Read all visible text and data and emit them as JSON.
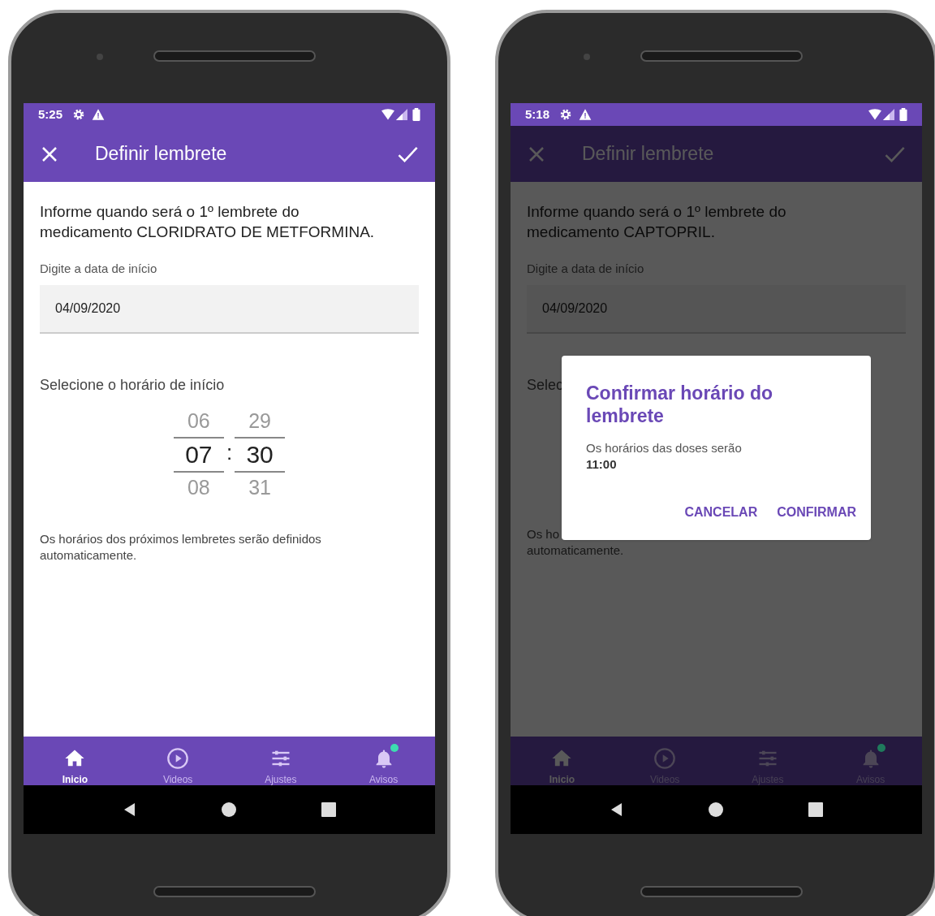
{
  "phones": [
    {
      "status_time": "5:25",
      "title": "Definir lembrete",
      "dimmed": false,
      "intro": "Informe quando será o 1º lembrete do medicamento CLORIDRATO DE METFORMINA.",
      "date_label": "Digite a data de início",
      "date_value": "04/09/2020",
      "time_label": "Selecione o horário de início",
      "picker": {
        "separator": ":",
        "hours": [
          {
            "value": "06",
            "selected": false
          },
          {
            "value": "07",
            "selected": true
          },
          {
            "value": "08",
            "selected": false
          }
        ],
        "minutes": [
          {
            "value": "29",
            "selected": false
          },
          {
            "value": "30",
            "selected": true
          },
          {
            "value": "31",
            "selected": false
          }
        ]
      },
      "note": [
        "Os horários dos próximos lembretes serão definidos",
        "automaticamente."
      ],
      "nav": [
        {
          "kind": "home",
          "label": "Inicio",
          "selected": true
        },
        {
          "kind": "play",
          "label": "Videos",
          "selected": false
        },
        {
          "kind": "sliders",
          "label": "Ajustes",
          "selected": false
        },
        {
          "kind": "bell",
          "label": "Avisos",
          "selected": false,
          "color": "#3ddbb0"
        }
      ]
    },
    {
      "status_time": "5:18",
      "title": "Definir lembrete",
      "dimmed": true,
      "intro": "Informe quando será o 1º lembrete do medicamento CAPTOPRIL.",
      "date_label": "Digite a data de início",
      "date_value": "04/09/2020",
      "time_label": "Selec",
      "note": [
        "Os ho",
        "automaticamente."
      ],
      "dialog": {
        "title": "Confirmar horário do lembrete",
        "message": "Os horários das doses serão",
        "time": "11:00",
        "buttons": [
          "CANCELAR",
          "CONFIRMAR"
        ]
      },
      "nav": [
        {
          "kind": "home",
          "label": "Inicio",
          "selected": true
        },
        {
          "kind": "play",
          "label": "Videos",
          "selected": false
        },
        {
          "kind": "sliders",
          "label": "Ajustes",
          "selected": false
        },
        {
          "kind": "bell",
          "label": "Avisos",
          "selected": false,
          "color": "#1f7a5c"
        }
      ]
    }
  ]
}
